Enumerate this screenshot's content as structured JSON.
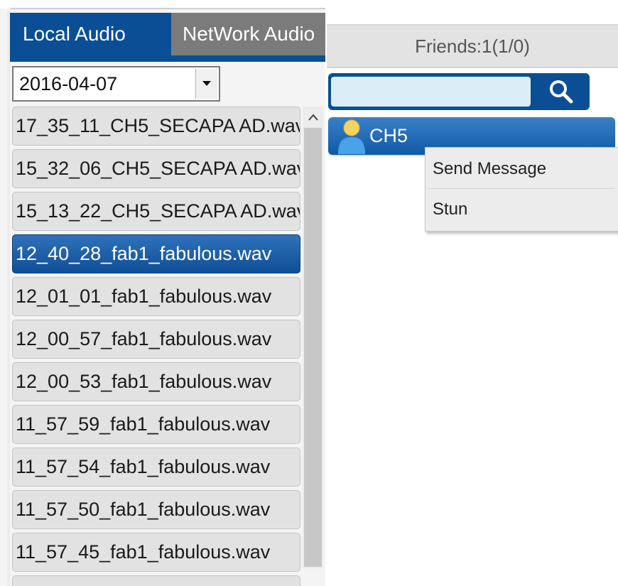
{
  "tabs": [
    {
      "label": "Local Audio",
      "active": true
    },
    {
      "label": "NetWork Audio",
      "active": false
    }
  ],
  "date_select": {
    "value": "2016-04-07"
  },
  "files": [
    {
      "name": "17_35_11_CH5_SECAPA AD.wav",
      "selected": false
    },
    {
      "name": "15_32_06_CH5_SECAPA AD.wav",
      "selected": false
    },
    {
      "name": "15_13_22_CH5_SECAPA AD.wav",
      "selected": false
    },
    {
      "name": "12_40_28_fab1_fabulous.wav",
      "selected": true
    },
    {
      "name": "12_01_01_fab1_fabulous.wav",
      "selected": false
    },
    {
      "name": "12_00_57_fab1_fabulous.wav",
      "selected": false
    },
    {
      "name": "12_00_53_fab1_fabulous.wav",
      "selected": false
    },
    {
      "name": "11_57_59_fab1_fabulous.wav",
      "selected": false
    },
    {
      "name": "11_57_54_fab1_fabulous.wav",
      "selected": false
    },
    {
      "name": "11_57_50_fab1_fabulous.wav",
      "selected": false
    },
    {
      "name": "11_57_45_fab1_fabulous.wav",
      "selected": false
    },
    {
      "name": "",
      "selected": false
    }
  ],
  "friends": {
    "header": "Friends:1(1/0)",
    "search_value": "",
    "items": [
      {
        "name": "CH5"
      }
    ]
  },
  "context_menu": {
    "items": [
      {
        "label": "Send Message"
      },
      {
        "label": "Stun"
      }
    ]
  },
  "colors": {
    "accent_blue": "#0a4f95",
    "tab_inactive": "#7b7b7b",
    "search_field": "#dbeef6"
  },
  "icons": [
    "chevron-down-icon",
    "scroll-up-arrow-icon",
    "search-icon",
    "user-icon"
  ]
}
